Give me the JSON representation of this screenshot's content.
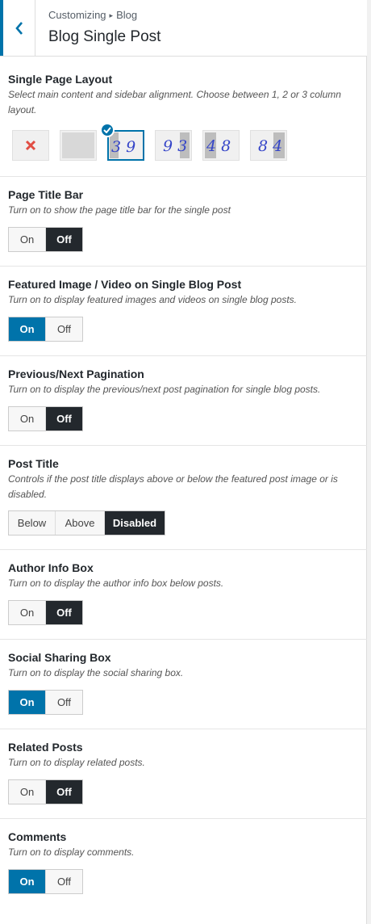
{
  "header": {
    "breadcrumb_parent": "Customizing",
    "breadcrumb_current": "Blog",
    "title": "Blog Single Post"
  },
  "layout": {
    "title": "Single Page Layout",
    "description": "Select main content and sidebar alignment. Choose between 1, 2 or 3 column layout.",
    "options": [
      {
        "name": "no-sidebar",
        "digits": ""
      },
      {
        "name": "full-width",
        "digits": ""
      },
      {
        "name": "left-sidebar",
        "digits": "3 9",
        "selected": true
      },
      {
        "name": "right-sidebar",
        "digits": "9 3"
      },
      {
        "name": "left-sidebar-wide",
        "digits": "4 8"
      },
      {
        "name": "right-sidebar-wide",
        "digits": "8 4"
      }
    ]
  },
  "page_title_bar": {
    "title": "Page Title Bar",
    "description": "Turn on to show the page title bar for the single post",
    "on": "On",
    "off": "Off",
    "selected": "off"
  },
  "featured_image": {
    "title": "Featured Image / Video on Single Blog Post",
    "description": "Turn on to display featured images and videos on single blog posts.",
    "on": "On",
    "off": "Off",
    "selected": "on"
  },
  "pagination": {
    "title": "Previous/Next Pagination",
    "description": "Turn on to display the previous/next post pagination for single blog posts.",
    "on": "On",
    "off": "Off",
    "selected": "off"
  },
  "post_title": {
    "title": "Post Title",
    "description": "Controls if the post title displays above or below the featured post image or is disabled.",
    "below": "Below",
    "above": "Above",
    "disabled": "Disabled",
    "selected": "disabled"
  },
  "author_info": {
    "title": "Author Info Box",
    "description": "Turn on to display the author info box below posts.",
    "on": "On",
    "off": "Off",
    "selected": "off"
  },
  "social_sharing": {
    "title": "Social Sharing Box",
    "description": "Turn on to display the social sharing box.",
    "on": "On",
    "off": "Off",
    "selected": "on"
  },
  "related_posts": {
    "title": "Related Posts",
    "description": "Turn on to display related posts.",
    "on": "On",
    "off": "Off",
    "selected": "off"
  },
  "comments": {
    "title": "Comments",
    "description": "Turn on to display comments.",
    "on": "On",
    "off": "Off",
    "selected": "on"
  },
  "colors": {
    "accent": "#0073aa",
    "dark": "#23282d",
    "remove": "#e14d43",
    "digits": "#3545c8"
  }
}
